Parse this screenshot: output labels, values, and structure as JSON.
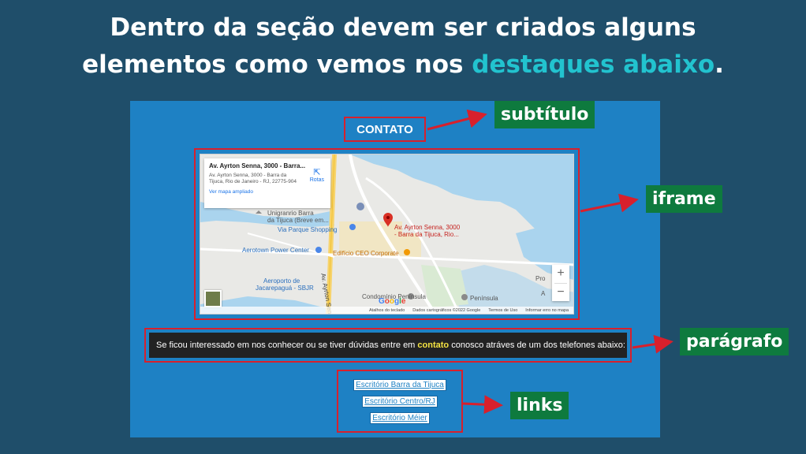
{
  "headline": {
    "line1": "Dentro da seção devem ser criados alguns",
    "line2_prefix": "elementos como vemos nos ",
    "line2_highlight": "destaques abaixo",
    "line2_suffix": "."
  },
  "section": {
    "subtitle": "CONTATO",
    "map": {
      "card_title": "Av. Ayrton Senna, 3000 - Barra...",
      "card_address": "Av. Ayrton Senna, 3000 - Barra da Tijuca, Rio de Janeiro - RJ, 22775-904",
      "card_link": "Ver mapa ampliado",
      "directions_label": "Rotas",
      "pin_label_line1": "Av. Ayrton Senna, 3000",
      "pin_label_line2": "- Barra da Tijuca, Rio...",
      "places": {
        "unigranrio": "Unigranrio Barra",
        "unigranrio2": "da Tijuca (Breve em...",
        "via_parque": "Via Parque Shopping",
        "aerotown": "Aerotown Power Center",
        "ceo": "Edifício CEO Corporate",
        "aeroporto1": "Aeroporto de",
        "aeroporto2": "Jacarepaguá - SBJR",
        "condominio": "Condomínio Península",
        "peninsula": "Península",
        "road": "Av. Ayrton Senna",
        "edge1": "Pro",
        "edge2": "A"
      },
      "zoom_in": "+",
      "zoom_out": "−",
      "google": "Google",
      "attribution": [
        "Atalhos do teclado",
        "Dados cartográficos ©2022 Google",
        "Termos de Uso",
        "Informar erro no mapa"
      ]
    },
    "paragraph": {
      "before": "Se ficou interessado em nos conhecer ou se tiver dúvidas entre em ",
      "highlight": "contato",
      "after": " conosco atráves de um dos telefones abaixo:"
    },
    "links": [
      "Escritório Barra da Tijuca",
      "Escritório Centro/RJ",
      "Escritório Méier"
    ]
  },
  "tags": {
    "subtitle": "subtítulo",
    "iframe": "iframe",
    "paragraph": "parágrafo",
    "links": "links"
  },
  "colors": {
    "background": "#1f4e6a",
    "panel": "#1e81c4",
    "highlight": "#22c3cf",
    "annotation": "#d8202c",
    "tag": "#0e7a3e"
  }
}
